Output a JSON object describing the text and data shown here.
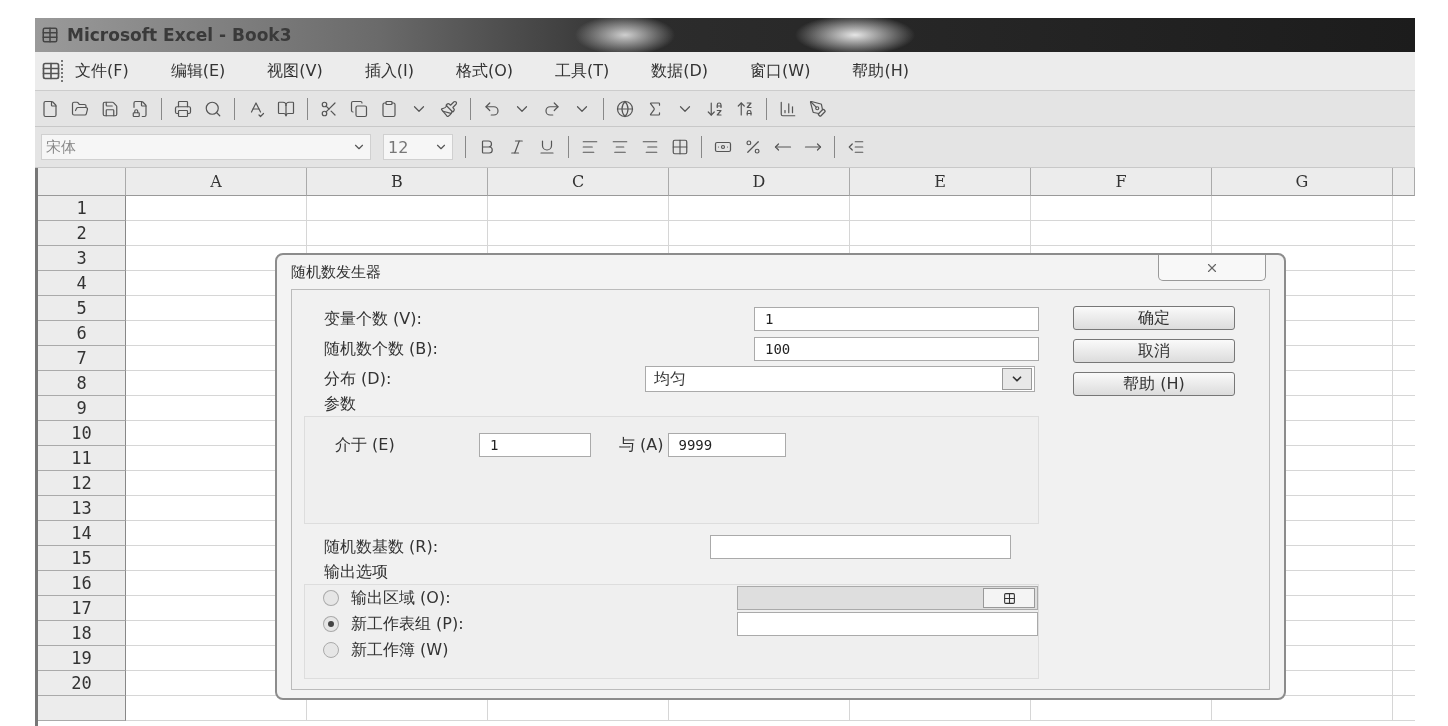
{
  "window": {
    "title": "Microsoft Excel - Book3"
  },
  "menu": [
    "文件(F)",
    "编辑(E)",
    "视图(V)",
    "插入(I)",
    "格式(O)",
    "工具(T)",
    "数据(D)",
    "窗口(W)",
    "帮助(H)"
  ],
  "format_bar": {
    "font": "宋体",
    "size": "12"
  },
  "sheet": {
    "columns": [
      "A",
      "B",
      "C",
      "D",
      "E",
      "F",
      "G"
    ],
    "rows": [
      "1",
      "2",
      "3",
      "4",
      "5",
      "6",
      "7",
      "8",
      "9",
      "10",
      "11",
      "12",
      "13",
      "14",
      "15",
      "16",
      "17",
      "18",
      "19",
      "20"
    ]
  },
  "dialog": {
    "title": "随机数发生器",
    "fields": [
      {
        "label": "变量个数 (V):",
        "value": "1"
      },
      {
        "label": "随机数个数 (B):",
        "value": "100"
      }
    ],
    "distribution": {
      "label": "分布 (D):",
      "value": "均匀"
    },
    "parameters": {
      "title": "参数",
      "from_label": "介于 (E)",
      "from_value": "1",
      "to_label": "与 (A)",
      "to_value": "9999"
    },
    "seed": {
      "label": "随机数基数 (R):"
    },
    "output": {
      "title": "输出选项",
      "options": [
        {
          "label": "输出区域 (O):",
          "selected": false,
          "kind": "range"
        },
        {
          "label": "新工作表组 (P):",
          "selected": true,
          "kind": "text"
        },
        {
          "label": "新工作簿 (W)",
          "selected": false,
          "kind": "plain"
        }
      ]
    },
    "buttons": [
      "确定",
      "取消",
      "帮助 (H)"
    ]
  }
}
